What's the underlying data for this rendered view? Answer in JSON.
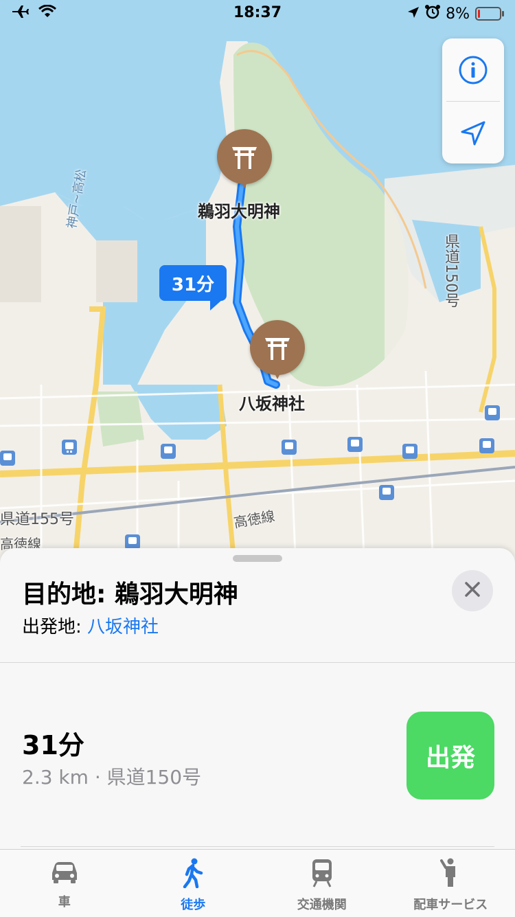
{
  "status_bar": {
    "time": "18:37",
    "battery": "8%",
    "battery_level": 0.08
  },
  "map": {
    "eta_bubble": "31分",
    "pins": [
      {
        "name": "鵜羽大明神"
      },
      {
        "name": "八坂神社"
      }
    ],
    "road_labels": {
      "kobe_takamatsu": "神戸~高松",
      "route150": "県道150号",
      "route155": "県道155号",
      "kotoku_line_1": "高徳線",
      "kotoku_line_2": "高徳線"
    }
  },
  "sheet": {
    "destination_label": "目的地: 鵜羽大明神",
    "origin_prefix": "出発地: ",
    "origin_link": "八坂神社",
    "route_time": "31分",
    "route_meta": "2.3 km · 県道150号",
    "go_button": "出発"
  },
  "tabs": [
    {
      "label": "車",
      "icon": "car-icon"
    },
    {
      "label": "徒歩",
      "icon": "walk-icon"
    },
    {
      "label": "交通機関",
      "icon": "train-icon"
    },
    {
      "label": "配車サービス",
      "icon": "rideshare-icon"
    }
  ],
  "colors": {
    "accent": "#1a78f0",
    "go": "#4cd964",
    "pin": "#9e7351",
    "water": "#a5d6f0",
    "park": "#cfe4c4"
  }
}
